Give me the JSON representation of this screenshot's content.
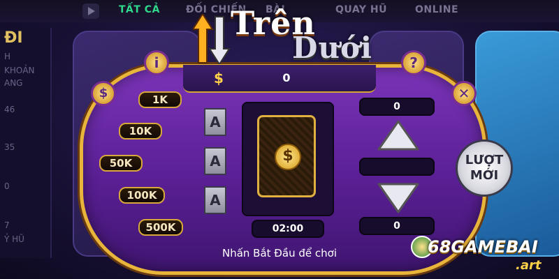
{
  "nav": {
    "tabs": [
      {
        "label": "TẤT CẢ",
        "active": true
      },
      {
        "label": "ĐỐI CHIẾN",
        "active": false
      },
      {
        "label": "BÀI",
        "active": false
      },
      {
        "label": "QUAY HŨ",
        "active": false
      },
      {
        "label": "ONLINE",
        "active": false
      }
    ]
  },
  "left_panel": {
    "heading": "ĐI",
    "lines": [
      "H",
      "KHOẢN",
      "ANG",
      "46",
      "35",
      "0",
      "7",
      "Ỷ HŨ"
    ]
  },
  "game": {
    "title_top": "Trên",
    "title_bottom": "Dưới",
    "balance_icon": "$",
    "balance": "0",
    "chips": [
      "1K",
      "10K",
      "50K",
      "100K",
      "500K"
    ],
    "history_cards": [
      "A",
      "A",
      "A"
    ],
    "card_symbol": "$",
    "timer": "02:00",
    "upper_value": "0",
    "middle_value": "",
    "lower_value": "0",
    "new_round_label_1": "LƯỢT",
    "new_round_label_2": "MỚI",
    "status": "Nhấn Bắt Đầu để chơi",
    "info_icon": "i",
    "help_icon": "?",
    "close_icon": "✕",
    "coin_bag_icon": "$"
  },
  "brand": {
    "name": "68GAMEBAI",
    "suffix": ".art"
  },
  "colors": {
    "table": "#6a2aa8",
    "rim": "#e8b43a",
    "active_tab": "#2fd88b"
  }
}
